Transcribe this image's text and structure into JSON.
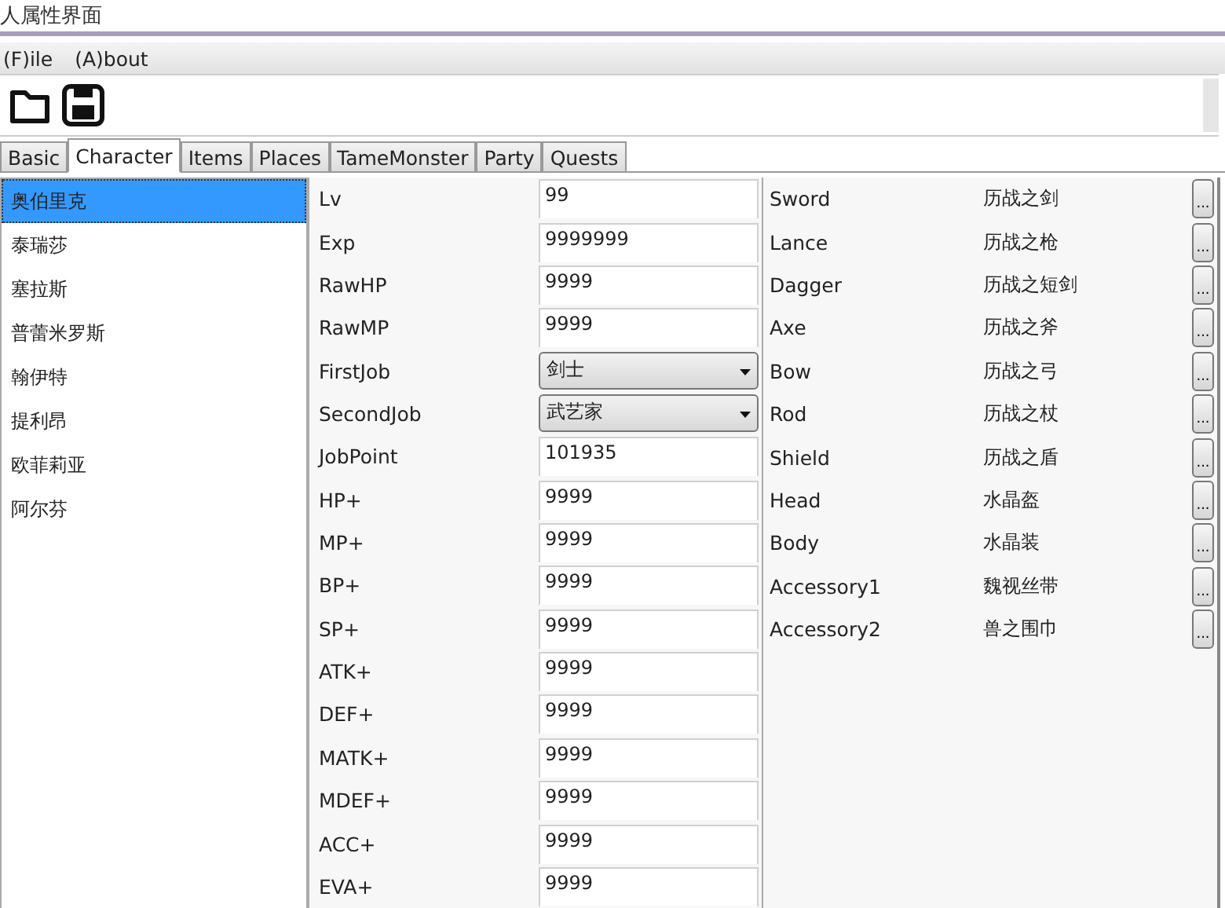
{
  "window": {
    "title": "人属性界面"
  },
  "menu": [
    "(F)ile",
    "(A)bout"
  ],
  "tabs": [
    {
      "label": "Basic",
      "selected": false
    },
    {
      "label": "Character",
      "selected": true
    },
    {
      "label": "Items",
      "selected": false
    },
    {
      "label": "Places",
      "selected": false
    },
    {
      "label": "TameMonster",
      "selected": false
    },
    {
      "label": "Party",
      "selected": false
    },
    {
      "label": "Quests",
      "selected": false
    }
  ],
  "characters": [
    {
      "name": "奥伯里克",
      "selected": true
    },
    {
      "name": "泰瑞莎",
      "selected": false
    },
    {
      "name": "塞拉斯",
      "selected": false
    },
    {
      "name": "普蕾米罗斯",
      "selected": false
    },
    {
      "name": "翰伊特",
      "selected": false
    },
    {
      "name": "提利昂",
      "selected": false
    },
    {
      "name": "欧菲莉亚",
      "selected": false
    },
    {
      "name": "阿尔芬",
      "selected": false
    }
  ],
  "stats": [
    {
      "label": "Lv",
      "kind": "text",
      "value": "99"
    },
    {
      "label": "Exp",
      "kind": "text",
      "value": "9999999"
    },
    {
      "label": "RawHP",
      "kind": "text",
      "value": "9999"
    },
    {
      "label": "RawMP",
      "kind": "text",
      "value": "9999"
    },
    {
      "label": "FirstJob",
      "kind": "dropdown",
      "value": "剑士"
    },
    {
      "label": "SecondJob",
      "kind": "dropdown",
      "value": "武艺家"
    },
    {
      "label": "JobPoint",
      "kind": "text",
      "value": "101935"
    },
    {
      "label": "HP+",
      "kind": "text",
      "value": "9999"
    },
    {
      "label": "MP+",
      "kind": "text",
      "value": "9999"
    },
    {
      "label": "BP+",
      "kind": "text",
      "value": "9999"
    },
    {
      "label": "SP+",
      "kind": "text",
      "value": "9999"
    },
    {
      "label": "ATK+",
      "kind": "text",
      "value": "9999"
    },
    {
      "label": "DEF+",
      "kind": "text",
      "value": "9999"
    },
    {
      "label": "MATK+",
      "kind": "text",
      "value": "9999"
    },
    {
      "label": "MDEF+",
      "kind": "text",
      "value": "9999"
    },
    {
      "label": "ACC+",
      "kind": "text",
      "value": "9999"
    },
    {
      "label": "EVA+",
      "kind": "text",
      "value": "9999"
    }
  ],
  "equipment": [
    {
      "slot": "Sword",
      "item": "历战之剑",
      "button": "..."
    },
    {
      "slot": "Lance",
      "item": "历战之枪",
      "button": "..."
    },
    {
      "slot": "Dagger",
      "item": "历战之短剑",
      "button": "..."
    },
    {
      "slot": "Axe",
      "item": "历战之斧",
      "button": "..."
    },
    {
      "slot": "Bow",
      "item": "历战之弓",
      "button": "..."
    },
    {
      "slot": "Rod",
      "item": "历战之杖",
      "button": "..."
    },
    {
      "slot": "Shield",
      "item": "历战之盾",
      "button": "..."
    },
    {
      "slot": "Head",
      "item": "水晶盔",
      "button": "..."
    },
    {
      "slot": "Body",
      "item": "水晶装",
      "button": "..."
    },
    {
      "slot": "Accessory1",
      "item": "魏视丝带",
      "button": "..."
    },
    {
      "slot": "Accessory2",
      "item": "兽之围巾",
      "button": "..."
    }
  ]
}
